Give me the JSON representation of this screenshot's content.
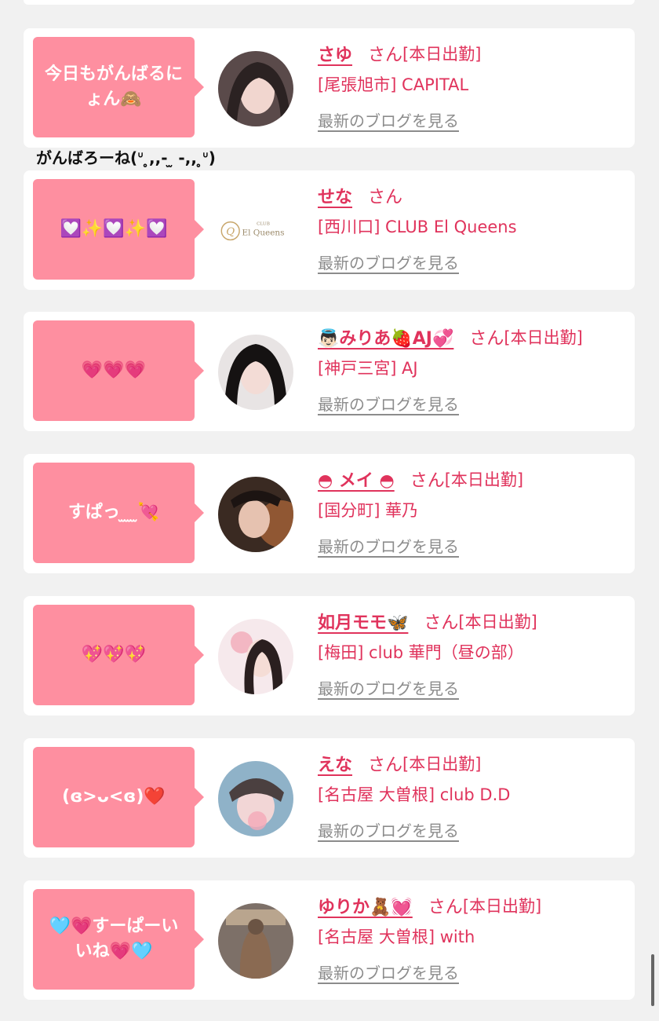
{
  "san_label": "さん",
  "blog_link_label": "最新のブログを見る",
  "caption": "がんばろーね(ᐡ ̥,,- ̫ -,, ̥ᐡ)",
  "colors": {
    "bubble": "#fe8fa0",
    "accent": "#e0335c",
    "link_gray": "#8c8c8c",
    "page_bg": "#f1f1f1"
  },
  "cards": [
    {
      "bubble": "今日もがんばるにょん🙈",
      "name": "さゆ",
      "status": "[本日出勤]",
      "shop": "[尾張旭市] CAPITAL",
      "avatar": "photo-avatar"
    },
    {
      "bubble": "💟✨💟✨💟",
      "name": "せな",
      "status": "",
      "shop": "[西川口] CLUB El Queens",
      "avatar": "club-logo",
      "logo_small": "CLUB",
      "logo_text": "El Queens"
    },
    {
      "bubble": "💗💗💗",
      "name": "👼🏻みりあ🍓AJ💞",
      "status": "[本日出勤]",
      "shop": "[神戸三宮] AJ",
      "avatar": "photo-avatar"
    },
    {
      "bubble": "すぱっ ̫ ̫ ̫💘",
      "name": "◓ メイ ◓",
      "status": "[本日出勤]",
      "shop": "[国分町] 華乃",
      "avatar": "photo-avatar"
    },
    {
      "bubble": "💖💖💖",
      "name": "如月モモ🦋",
      "status": "[本日出勤]",
      "shop": "[梅田] club 華門（昼の部）",
      "avatar": "photo-avatar"
    },
    {
      "bubble": "(ɞ>ᴗ<ɞ)❤️",
      "name": "えな",
      "status": "[本日出勤]",
      "shop": "[名古屋 大曽根] club D.D",
      "avatar": "photo-avatar"
    },
    {
      "bubble": "🩵💗すーぱーいいね💗🩵",
      "name": "ゆりか🧸💓",
      "status": "[本日出勤]",
      "shop": "[名古屋 大曽根] with",
      "avatar": "photo-avatar"
    }
  ]
}
